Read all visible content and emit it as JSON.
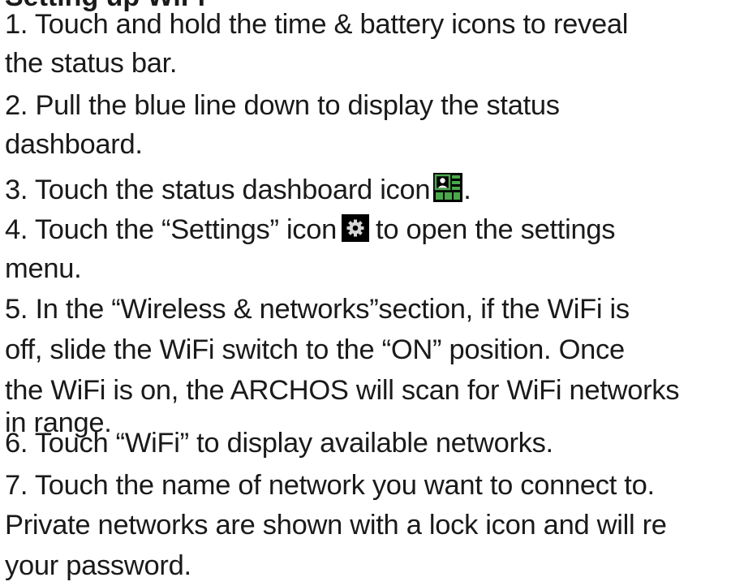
{
  "heading": "Setting up WiFi",
  "steps": {
    "s1_a": "1. Touch and hold the time & battery icons to reveal",
    "s1_b": "the status bar.",
    "s2_a": "2. Pull the blue line down to display the status",
    "s2_b": "dashboard.",
    "s3_a": "3. Touch the status dashboard icon",
    "s3_b": ".",
    "s4_a": "4. Touch the “Settings”  icon",
    "s4_b": "to open the settings",
    "s4_c": "menu.",
    "s5_a": "5. In the “Wireless & networks”section, if the WiFi is",
    "s5_b": "off, slide the WiFi switch to the “ON” position. Once",
    "s5_c": "the WiFi is on, the ARCHOS will scan for WiFi networks",
    "s5_d": "in range.",
    "s6": "6. Touch “WiFi” to display available networks.",
    "s7_a": "7. Touch the name of network you want to connect to.",
    "s7_b": "Private networks are shown with a lock icon and will re",
    "s7_c": "your password."
  },
  "icons": {
    "dashboard": "status-dashboard-icon",
    "settings": "settings-gear-icon"
  }
}
